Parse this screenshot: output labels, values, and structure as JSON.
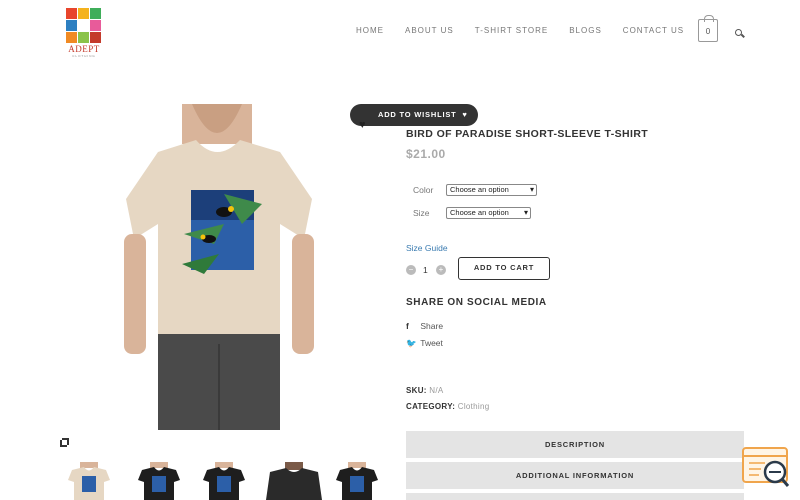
{
  "brand": {
    "logo_text": "ADEPT",
    "logo_sub": "CLOTHING"
  },
  "nav": {
    "items": [
      "HOME",
      "ABOUT US",
      "T-SHIRT STORE",
      "BLOGS",
      "CONTACT US"
    ],
    "cart_count": "0"
  },
  "product": {
    "wishlist_label": "ADD TO WISHLIST",
    "title": "BIRD OF PARADISE SHORT-SLEEVE T-SHIRT",
    "price": "$21.00",
    "options": [
      {
        "label": "Color",
        "value": "Choose an option"
      },
      {
        "label": "Size",
        "value": "Choose an option"
      }
    ],
    "size_guide": "Size Guide",
    "quantity": "1",
    "add_to_cart": "ADD TO CART",
    "share_heading": "SHARE ON SOCIAL MEDIA",
    "share_links": [
      "Share",
      "Tweet"
    ],
    "sku_label": "SKU:",
    "sku_value": "N/A",
    "category_label": "CATEGORY:",
    "category_value": "Clothing",
    "tabs": [
      "DESCRIPTION",
      "ADDITIONAL INFORMATION"
    ]
  },
  "colors": {
    "shirt_cream": "#e6d7c3",
    "shirt_black": "#1e1e1e",
    "accent_link": "#3a7bb0",
    "tab_bg": "#e4e4e4",
    "widget_orange": "#f0a54c"
  },
  "icons": [
    "heart-icon",
    "expand-icon",
    "cart-icon",
    "search-icon",
    "facebook-icon",
    "twitter-icon",
    "chat-widget-icon"
  ]
}
